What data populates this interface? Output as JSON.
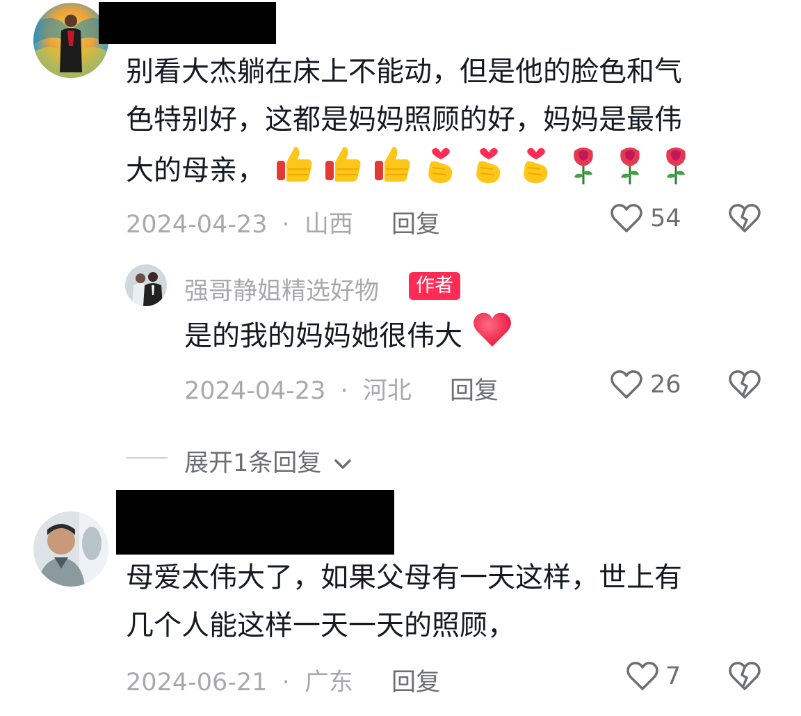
{
  "comments": [
    {
      "text_line1": "别看大杰躺在床上不能动，但是他的脸色和气",
      "text_line2": "色特别好，这都是妈妈照顾的好，妈妈是最伟",
      "text_line3": "大的母亲，",
      "emojis": [
        "thumbs-up",
        "thumbs-up",
        "thumbs-up",
        "finger-heart",
        "finger-heart",
        "finger-heart",
        "rose",
        "rose",
        "rose"
      ],
      "date": "2024-04-23",
      "separator": "·",
      "location": "山西",
      "reply_label": "回复",
      "likes": "54",
      "reply": {
        "author": "强哥静姐精选好物",
        "badge": "作者",
        "text": "是的我的妈妈她很伟大",
        "date": "2024-04-23",
        "separator": "·",
        "location": "河北",
        "reply_label": "回复",
        "likes": "26"
      },
      "expand_label": "展开1条回复"
    },
    {
      "text_line1": "母爱太伟大了，如果父母有一天这样，世上有",
      "text_line2": "几个人能这样一天一天的照顾，",
      "date": "2024-06-21",
      "separator": "·",
      "location": "广东",
      "reply_label": "回复",
      "likes": "7"
    }
  ],
  "colors": {
    "text": "#161823",
    "meta": "#a9a9ad",
    "secondary": "#6d6e73",
    "badge": "#fe2c55",
    "heart": "#ff2a4f"
  },
  "icons": [
    "heart-outline-icon",
    "broken-heart-icon",
    "chevron-down-icon",
    "thumbs-up-emoji",
    "finger-heart-emoji",
    "rose-emoji",
    "red-heart-emoji"
  ]
}
